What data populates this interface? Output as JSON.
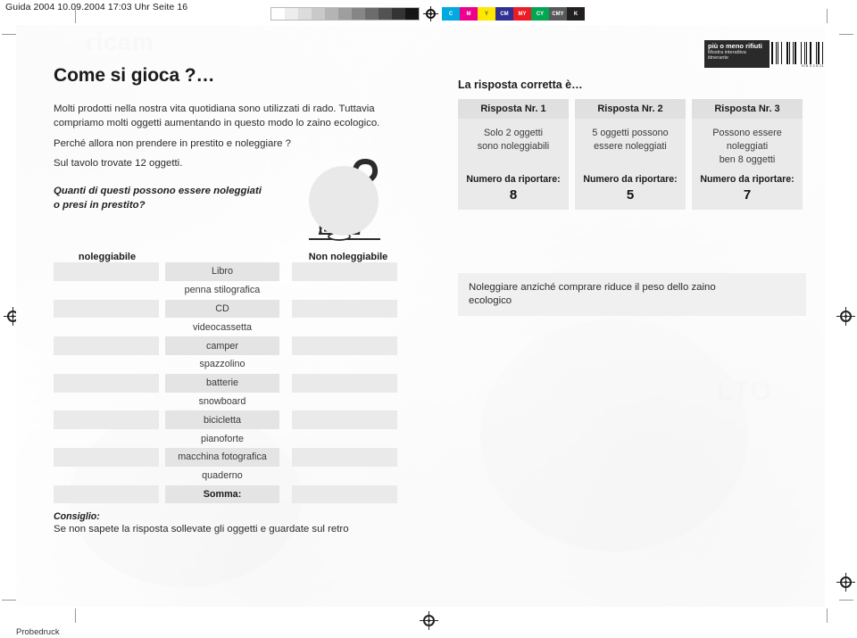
{
  "proof": {
    "header": "Guida 2004 10.09.2004 17:03 Uhr Seite 16",
    "footer": "Probedruck",
    "colorbar": {
      "gray_steps": [
        "#ffffff",
        "#ededed",
        "#dcdcdc",
        "#c9c9c9",
        "#b4b4b4",
        "#9e9e9e",
        "#868686",
        "#6c6c6c",
        "#525252",
        "#343434",
        "#151515"
      ],
      "cmyk_patches": [
        {
          "label": "C",
          "color": "#00a9e0"
        },
        {
          "label": "M",
          "color": "#ec008c"
        },
        {
          "label": "Y",
          "color": "#ffe800"
        },
        {
          "label": "CM",
          "color": "#2e3192"
        },
        {
          "label": "MY",
          "color": "#ed1c24"
        },
        {
          "label": "CY",
          "color": "#00a651"
        },
        {
          "label": "CMY",
          "color": "#58595b"
        },
        {
          "label": "K",
          "color": "#231f20"
        }
      ],
      "registration_icon": "registration-target-icon"
    }
  },
  "badge": {
    "title": "più o meno rifiuti",
    "subtitle_line1": "Mostra interattiva",
    "subtitle_line2": "itinerante",
    "barcode_number": "978 3 2 8 21",
    "icon": "barcode-icon"
  },
  "left": {
    "title": "Come si gioca ?…",
    "paragraph1": "Molti prodotti nella nostra vita quotidiana sono utilizzati di rado. Tuttavia compriamo molti oggetti aumentando in questo modo lo zaino ecologico.",
    "paragraph2": "Perché allora non prendere in prestito e noleggiare ?",
    "paragraph3": "Sul tavolo trovate 12 oggetti.",
    "question_line1": "Quanti di questi possono essere noleggiati",
    "question_line2": "o presi in prestito?"
  },
  "table": {
    "header_left": "noleggiabile",
    "header_right": "Non noleggiabile",
    "items": [
      "Libro",
      "penna stilografica",
      "CD",
      "videocassetta",
      "camper",
      "spazzolino",
      "batterie",
      "snowboard",
      "bicicletta",
      "pianoforte",
      "macchina fotografica",
      "quaderno"
    ],
    "sum_label": "Somma:"
  },
  "character": {
    "icon": "thinking-person-icon",
    "question_mark": "?"
  },
  "right": {
    "answers_title": "La risposta corretta è…",
    "cards": [
      {
        "header": "Risposta Nr. 1",
        "body_line1": "Solo 2 oggetti",
        "body_line2": "sono noleggiabili",
        "body_line3": "",
        "report_label": "Numero da riportare:",
        "number": "8"
      },
      {
        "header": "Risposta Nr. 2",
        "body_line1": "5 oggetti possono",
        "body_line2": "essere noleggiati",
        "body_line3": "",
        "report_label": "Numero da riportare:",
        "number": "5"
      },
      {
        "header": "Risposta Nr. 3",
        "body_line1": "Possono essere",
        "body_line2": "noleggiati",
        "body_line3": "ben 8 oggetti",
        "report_label": "Numero da riportare:",
        "number": "7"
      }
    ],
    "info_line1": "Noleggiare anziché comprare riduce il peso dello zaino",
    "info_line2": "ecologico"
  },
  "advice": {
    "label": "Consiglio:",
    "text": "Se non sapete la risposta sollevate gli oggetti e guardate sul retro"
  },
  "photo": {
    "ghost_text_1": "ricam",
    "ghost_text_2": "LTO"
  }
}
